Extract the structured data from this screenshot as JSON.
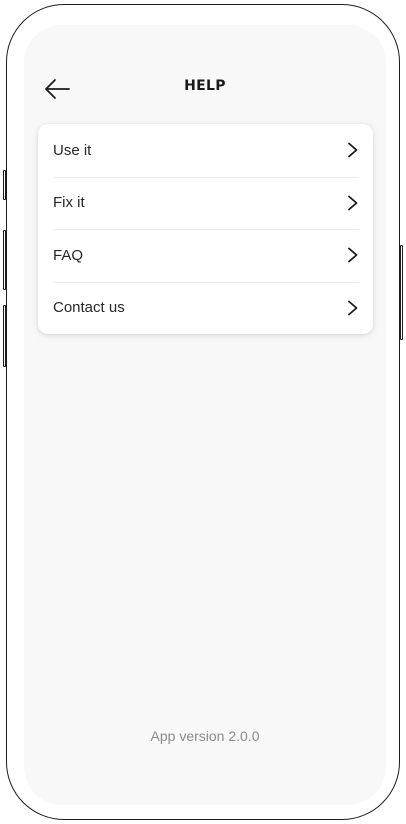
{
  "header": {
    "title": "HELP",
    "back_icon": "arrow-left-icon"
  },
  "menu": {
    "items": [
      {
        "label": "Use it",
        "icon": "chevron-right-icon"
      },
      {
        "label": "Fix it",
        "icon": "chevron-right-icon"
      },
      {
        "label": "FAQ",
        "icon": "chevron-right-icon"
      },
      {
        "label": "Contact us",
        "icon": "chevron-right-icon"
      }
    ]
  },
  "footer": {
    "app_version": "App version 2.0.0"
  },
  "colors": {
    "screen_background": "#f8f8f8",
    "card_background": "#ffffff",
    "text_primary": "#262626",
    "text_muted": "#8a8a8a",
    "frame": "#1c1c1c"
  }
}
